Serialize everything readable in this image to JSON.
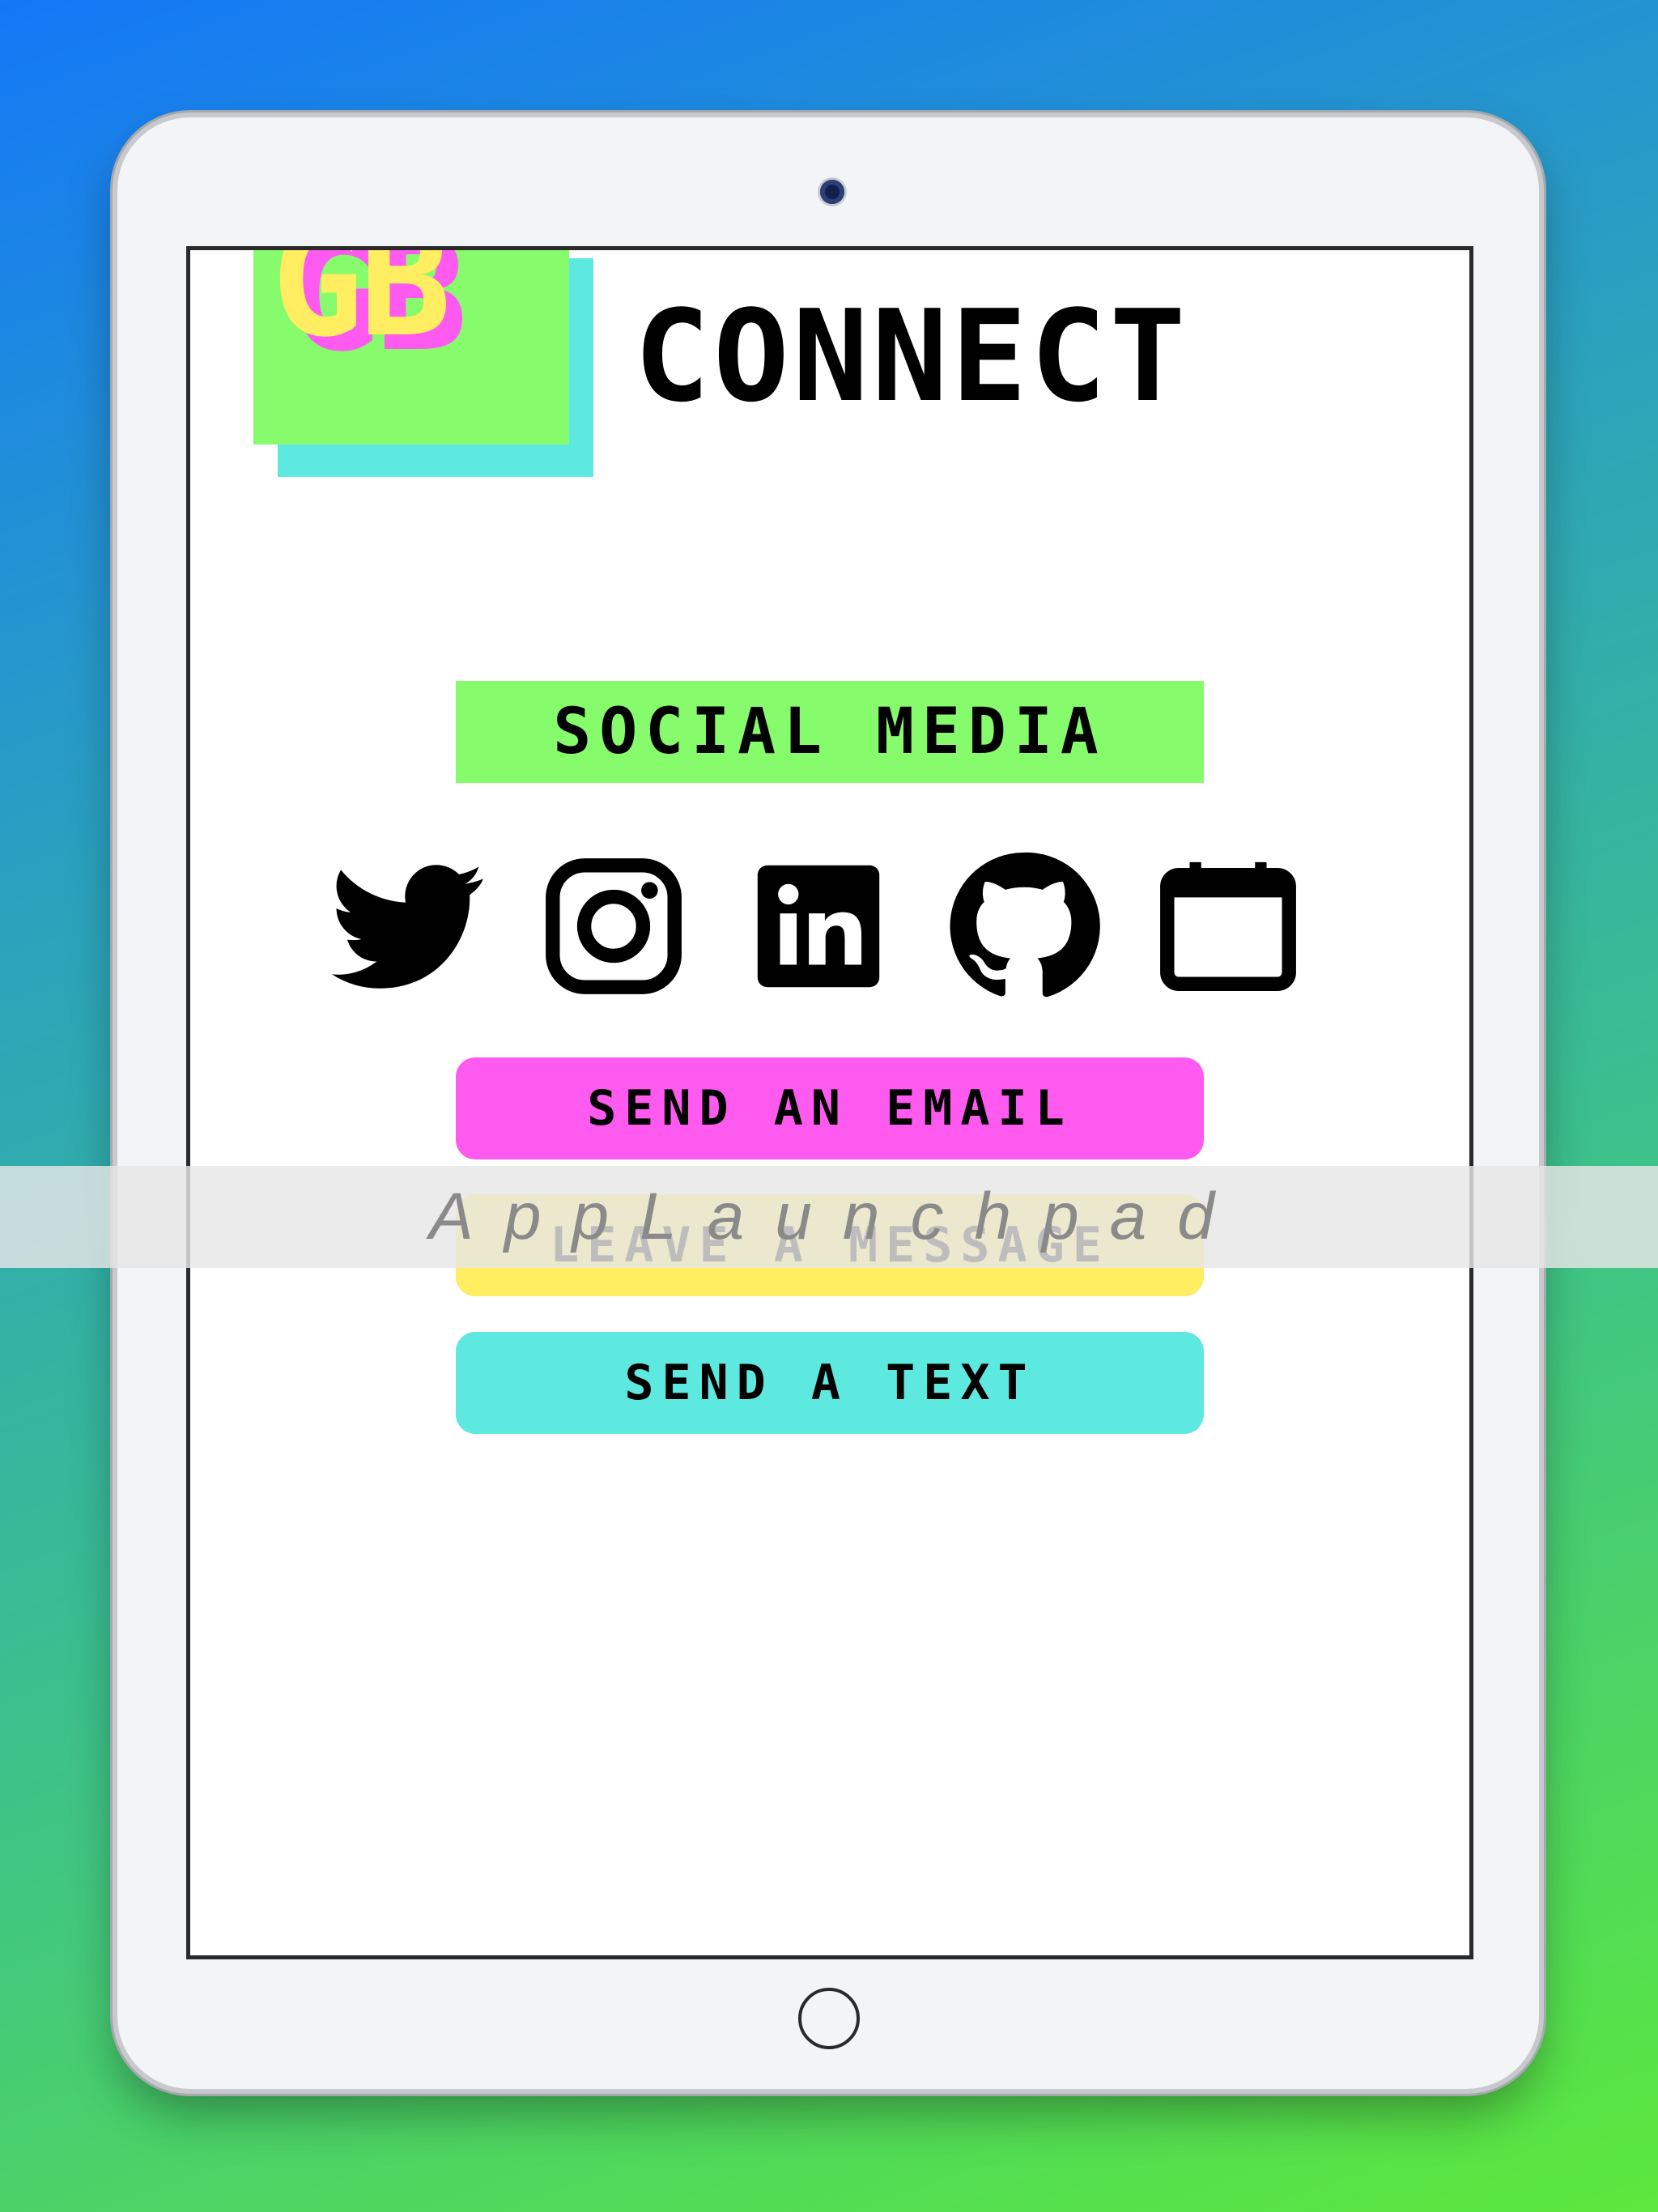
{
  "app": {
    "logo_text": "GB",
    "title": "CONNECT"
  },
  "social": {
    "section_label": "SOCIAL MEDIA",
    "icons": [
      "twitter-icon",
      "instagram-icon",
      "linkedin-icon",
      "github-icon",
      "calendar-icon"
    ]
  },
  "actions": {
    "email_label": "SEND AN EMAIL",
    "message_label": "LEAVE A MESSAGE",
    "text_label": "SEND A TEXT"
  },
  "watermark": {
    "text": "AppLaunchpad"
  },
  "colors": {
    "green": "#86fb6c",
    "pink": "#ff5af0",
    "yellow": "#ffed62",
    "cyan": "#5de8e0"
  }
}
